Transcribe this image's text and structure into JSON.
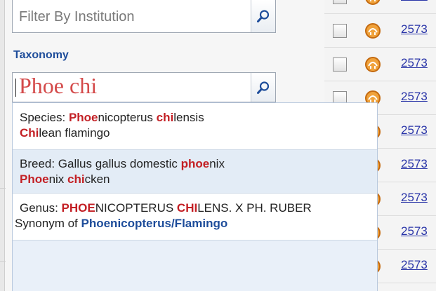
{
  "filter": {
    "placeholder": "Filter By Institution",
    "search_icon": "magnifier-icon"
  },
  "taxonomy": {
    "label": "Taxonomy",
    "value": "Phoe chi",
    "search_icon": "magnifier-icon"
  },
  "suggestions": [
    {
      "line1": [
        {
          "text": "Species: ",
          "style": "plain"
        },
        {
          "text": "Phoe",
          "style": "hl"
        },
        {
          "text": "nicopterus ",
          "style": "plain"
        },
        {
          "text": "chi",
          "style": "hl"
        },
        {
          "text": "lensis",
          "style": "plain"
        }
      ],
      "line2": [
        {
          "text": "Chi",
          "style": "hl"
        },
        {
          "text": "lean flamingo",
          "style": "plain"
        }
      ]
    },
    {
      "line1": [
        {
          "text": "Breed: Gallus gallus domestic ",
          "style": "plain"
        },
        {
          "text": "phoe",
          "style": "hl"
        },
        {
          "text": "nix",
          "style": "plain"
        }
      ],
      "line2": [
        {
          "text": "Phoe",
          "style": "hl"
        },
        {
          "text": "nix ",
          "style": "plain"
        },
        {
          "text": "chi",
          "style": "hl"
        },
        {
          "text": "cken",
          "style": "plain"
        }
      ]
    },
    {
      "line1": [
        {
          "text": "Genus: ",
          "style": "plain"
        },
        {
          "text": "PHOE",
          "style": "hl"
        },
        {
          "text": "NICOPTERUS ",
          "style": "plain"
        },
        {
          "text": "CHI",
          "style": "hl"
        },
        {
          "text": "LENS. X PH. RUBER",
          "style": "plain"
        }
      ],
      "line2": [
        {
          "text": "Synonym of ",
          "style": "plain"
        },
        {
          "text": "Phoenicopterus/Flamingo",
          "style": "blue"
        }
      ]
    }
  ],
  "results": {
    "link_text": "2573",
    "row_icon": "bird-type-icon",
    "colors": {
      "icon_fill": "#f0a23b",
      "icon_stroke": "#c46a10",
      "link": "#2a35a8"
    }
  }
}
